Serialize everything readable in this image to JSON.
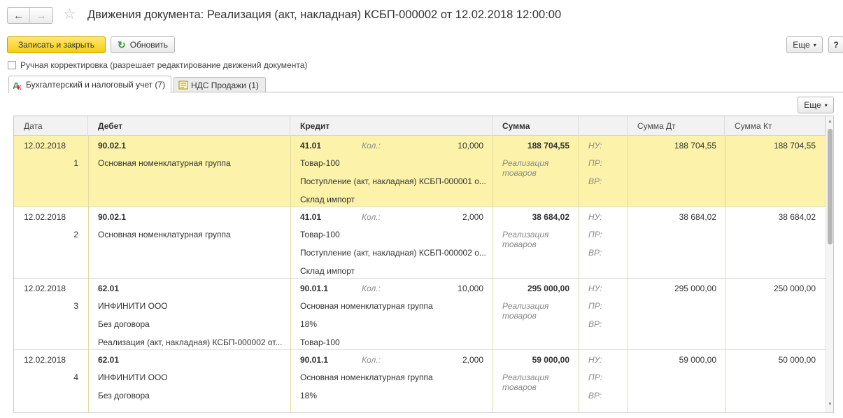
{
  "window": {
    "title": "Движения документа: Реализация (акт, накладная) КСБП-000002 от 12.02.2018 12:00:00",
    "back_icon": "←",
    "forward_icon": "→",
    "star_icon": "☆"
  },
  "toolbar": {
    "save_close_label": "Записать и закрыть",
    "refresh_label": "Обновить",
    "refresh_icon": "↻",
    "more_label": "Еще",
    "more_caret": "▾",
    "help_label": "?"
  },
  "manual_edit": {
    "label": "Ручная корректировка (разрешает редактирование движений документа)"
  },
  "tabs": [
    {
      "label": "Бухгалтерский и налоговый учет (7)"
    },
    {
      "label": "НДС Продажи (1)"
    }
  ],
  "grid": {
    "more_label": "Еще",
    "columns": {
      "date": "Дата",
      "debit": "Дебет",
      "credit": "Кредит",
      "sum": "Сумма",
      "sum_dt": "Сумма Дт",
      "sum_kt": "Сумма Кт"
    },
    "rows": [
      {
        "date": "12.02.2018",
        "num": "1",
        "debit_account": "90.02.1",
        "debit_sub1": "Основная номенклатурная группа",
        "debit_sub2": "",
        "debit_sub3": "",
        "credit_account": "41.01",
        "qty_label": "Кол.:",
        "qty": "10,000",
        "credit_sub1": "Товар-100",
        "credit_sub2": "Поступление (акт, накладная) КСБП-000001 о...",
        "credit_sub3": "Склад импорт",
        "sum": "188 704,55",
        "content": "Реализация товаров",
        "nu": "НУ:",
        "pr": "ПР:",
        "vr": "ВР:",
        "sum_dt": "188 704,55",
        "sum_kt": "188 704,55"
      },
      {
        "date": "12.02.2018",
        "num": "2",
        "debit_account": "90.02.1",
        "debit_sub1": "Основная номенклатурная группа",
        "debit_sub2": "",
        "debit_sub3": "",
        "credit_account": "41.01",
        "qty_label": "Кол.:",
        "qty": "2,000",
        "credit_sub1": "Товар-100",
        "credit_sub2": "Поступление (акт, накладная) КСБП-000002 о...",
        "credit_sub3": "Склад импорт",
        "sum": "38 684,02",
        "content": "Реализация товаров",
        "nu": "НУ:",
        "pr": "ПР:",
        "vr": "ВР:",
        "sum_dt": "38 684,02",
        "sum_kt": "38 684,02"
      },
      {
        "date": "12.02.2018",
        "num": "3",
        "debit_account": "62.01",
        "debit_sub1": "ИНФИНИТИ ООО",
        "debit_sub2": "Без договора",
        "debit_sub3": "Реализация (акт, накладная) КСБП-000002 от...",
        "credit_account": "90.01.1",
        "qty_label": "Кол.:",
        "qty": "10,000",
        "credit_sub1": "Основная номенклатурная группа",
        "credit_sub2": "18%",
        "credit_sub3": "Товар-100",
        "sum": "295 000,00",
        "content": "Реализация товаров",
        "nu": "НУ:",
        "pr": "ПР:",
        "vr": "ВР:",
        "sum_dt": "295 000,00",
        "sum_kt": "250 000,00"
      },
      {
        "date": "12.02.2018",
        "num": "4",
        "debit_account": "62.01",
        "debit_sub1": "ИНФИНИТИ ООО",
        "debit_sub2": "Без договора",
        "debit_sub3": "",
        "credit_account": "90.01.1",
        "qty_label": "Кол.:",
        "qty": "2,000",
        "credit_sub1": "Основная номенклатурная группа",
        "credit_sub2": "18%",
        "credit_sub3": "",
        "sum": "59 000,00",
        "content": "Реализация товаров",
        "nu": "НУ:",
        "pr": "ПР:",
        "vr": "ВР:",
        "sum_dt": "59 000,00",
        "sum_kt": "50 000,00"
      }
    ]
  },
  "colors": {
    "primary_button": "#f6cd13",
    "selected_row": "#fdf2a9",
    "header_bg": "#f2f2f2"
  }
}
